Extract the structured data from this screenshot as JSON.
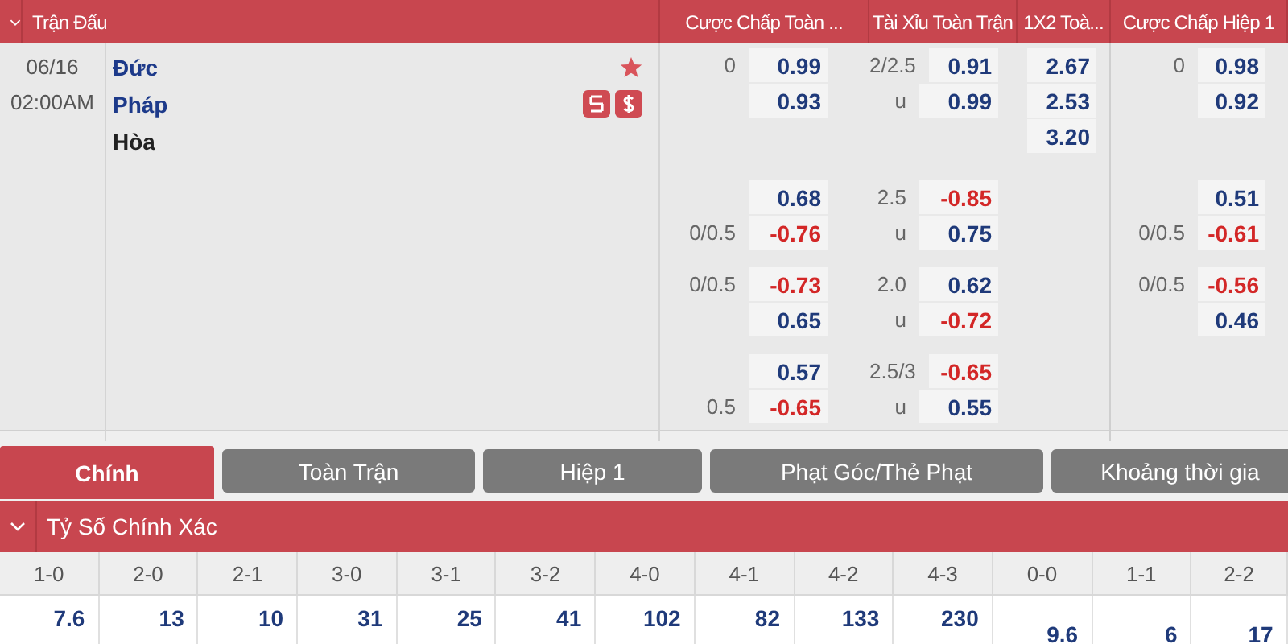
{
  "header": {
    "match_title": "Trận Đấu"
  },
  "match": {
    "date": "06/16",
    "time": "02:00AM",
    "home": "Đức",
    "away": "Pháp",
    "draw": "Hòa"
  },
  "markets": [
    {
      "title": "Cược Chấp Toàn ...",
      "blocks": [
        [
          {
            "line": "0",
            "odd": "0.99",
            "negative": false
          },
          {
            "odd": "0.93",
            "negative": false
          }
        ],
        [
          {
            "odd": "0.68",
            "negative": false
          },
          {
            "line": "0/0.5",
            "odd": "-0.76",
            "negative": true
          }
        ],
        [
          {
            "line": "0/0.5",
            "odd": "-0.73",
            "negative": true
          },
          {
            "odd": "0.65",
            "negative": false
          }
        ],
        [
          {
            "odd": "0.57",
            "negative": false
          },
          {
            "line": "0.5",
            "odd": "-0.65",
            "negative": true
          }
        ]
      ]
    },
    {
      "title": "Tài Xỉu Toàn Trận",
      "blocks": [
        [
          {
            "line": "2/2.5",
            "odd": "0.91",
            "negative": false
          },
          {
            "line": "u",
            "odd": "0.99",
            "negative": false
          }
        ],
        [
          {
            "line": "2.5",
            "odd": "-0.85",
            "negative": true
          },
          {
            "line": "u",
            "odd": "0.75",
            "negative": false
          }
        ],
        [
          {
            "line": "2.0",
            "odd": "0.62",
            "negative": false
          },
          {
            "line": "u",
            "odd": "-0.72",
            "negative": true
          }
        ],
        [
          {
            "line": "2.5/3",
            "odd": "-0.65",
            "negative": true
          },
          {
            "line": "u",
            "odd": "0.55",
            "negative": false
          }
        ]
      ]
    },
    {
      "title": "1X2 Toà...",
      "blocks": [
        [
          {
            "odd": "2.67",
            "negative": false
          },
          {
            "odd": "2.53",
            "negative": false
          },
          {
            "odd": "3.20",
            "negative": false
          }
        ]
      ]
    },
    {
      "title": "Cược Chấp Hiệp 1",
      "blocks": [
        [
          {
            "line": "0",
            "odd": "0.98",
            "negative": false
          },
          {
            "odd": "0.92",
            "negative": false
          }
        ],
        [
          {
            "odd": "0.51",
            "negative": false
          },
          {
            "line": "0/0.5",
            "odd": "-0.61",
            "negative": true
          }
        ],
        [
          {
            "line": "0/0.5",
            "odd": "-0.56",
            "negative": true
          },
          {
            "odd": "0.46",
            "negative": false
          }
        ]
      ]
    }
  ],
  "tabs": [
    {
      "label": "Chính",
      "selected": true
    },
    {
      "label": "Toàn Trận",
      "selected": false
    },
    {
      "label": "Hiệp 1",
      "selected": false
    },
    {
      "label": "Phạt Góc/Thẻ Phạt",
      "selected": false
    },
    {
      "label": "Khoảng thời gia",
      "selected": false
    }
  ],
  "section": {
    "title": "Tỷ Số Chính Xác",
    "expanded": true
  },
  "scores": [
    {
      "label": "1-0",
      "odds": "7.6",
      "kind": "single"
    },
    {
      "label": "2-0",
      "odds": "13",
      "kind": "single"
    },
    {
      "label": "2-1",
      "odds": "10",
      "kind": "single"
    },
    {
      "label": "3-0",
      "odds": "31",
      "kind": "single"
    },
    {
      "label": "3-1",
      "odds": "25",
      "kind": "single"
    },
    {
      "label": "3-2",
      "odds": "41",
      "kind": "single"
    },
    {
      "label": "4-0",
      "odds": "102",
      "kind": "single"
    },
    {
      "label": "4-1",
      "odds": "82",
      "kind": "single"
    },
    {
      "label": "4-2",
      "odds": "133",
      "kind": "single"
    },
    {
      "label": "4-3",
      "odds": "230",
      "kind": "single"
    },
    {
      "label": "0-0",
      "odds": "9.6",
      "kind": "merged"
    },
    {
      "label": "1-1",
      "odds": "6",
      "kind": "merged"
    },
    {
      "label": "2-2",
      "odds": "17",
      "kind": "merged"
    }
  ]
}
